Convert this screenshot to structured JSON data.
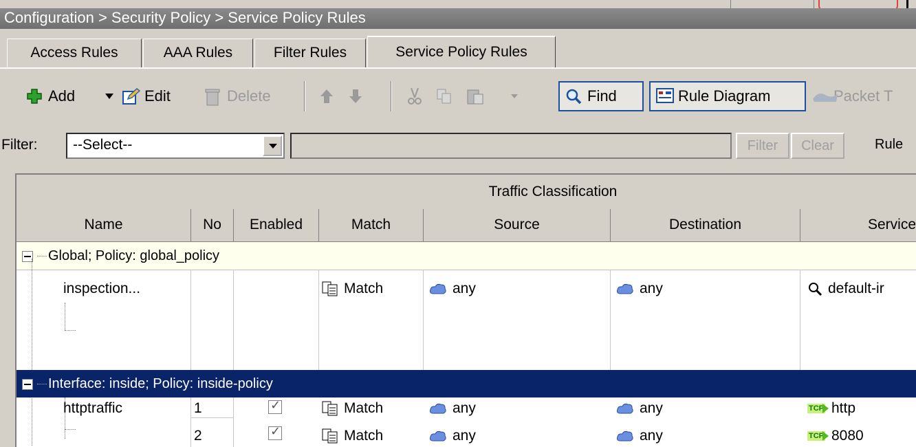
{
  "breadcrumb": "Configuration > Security Policy > Service Policy Rules",
  "tabs": [
    "Access Rules",
    "AAA Rules",
    "Filter Rules",
    "Service Policy Rules"
  ],
  "toolbar": {
    "add": "Add",
    "edit": "Edit",
    "delete": "Delete",
    "find": "Find",
    "rule_diagram": "Rule Diagram",
    "packet_tracer": "Packet T"
  },
  "filter": {
    "label": "Filter:",
    "select_value": "--Select--",
    "filter_btn": "Filter",
    "clear_btn": "Clear",
    "rule_btn": "Rule"
  },
  "table": {
    "group_header": "Traffic Classification",
    "columns": [
      "Name",
      "No",
      "Enabled",
      "Match",
      "Source",
      "Destination",
      "Service"
    ],
    "groups": [
      {
        "label": "Global; Policy: global_policy",
        "rows": [
          {
            "name": "inspection...",
            "no": "",
            "enabled": false,
            "match": "Match",
            "source": "any",
            "destination": "any",
            "service": "default-ir"
          }
        ]
      },
      {
        "label": "Interface: inside; Policy: inside-policy",
        "rows": [
          {
            "name": "httptraffic",
            "no": "1",
            "enabled": true,
            "match": "Match",
            "source": "any",
            "destination": "any",
            "service": "http"
          },
          {
            "name": "",
            "no": "2",
            "enabled": true,
            "match": "Match",
            "source": "any",
            "destination": "any",
            "service": "8080"
          }
        ]
      }
    ]
  }
}
